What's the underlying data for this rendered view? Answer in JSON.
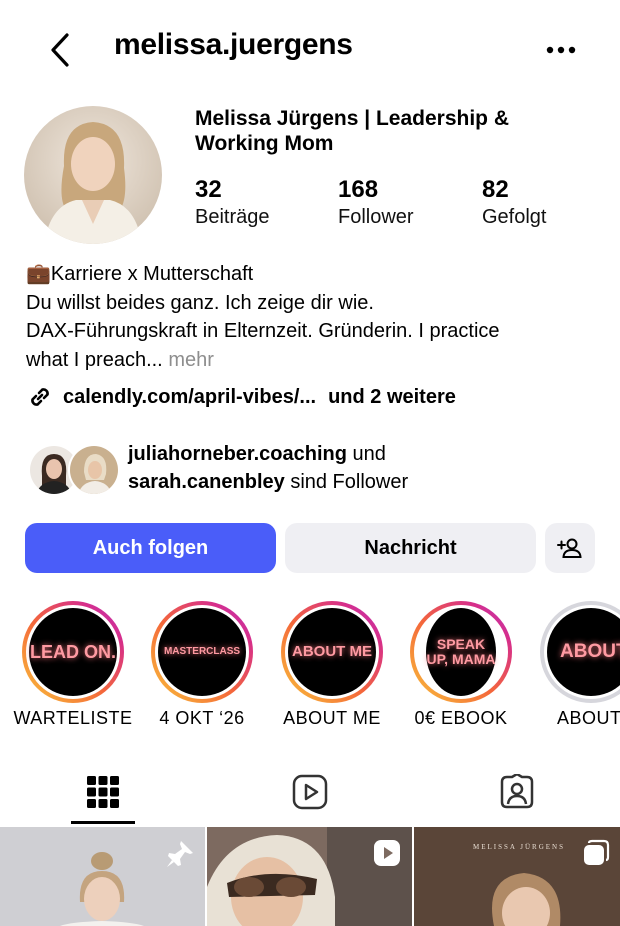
{
  "header": {
    "username": "melissa.juergens",
    "back_icon": "chevron-left-icon",
    "more_icon": "more-horizontal-icon"
  },
  "profile": {
    "display_name": "Melissa Jürgens | Leadership & Working Mom",
    "stats": [
      {
        "value": "32",
        "label": "Beiträge"
      },
      {
        "value": "168",
        "label": "Follower"
      },
      {
        "value": "82",
        "label": "Gefolgt"
      }
    ],
    "bio": {
      "line1_emoji": "💼",
      "line1": "Karriere x Mutterschaft",
      "line2": "Du willst beides ganz. Ich zeige dir wie.",
      "line3": "DAX-Führungskraft in Elternzeit. Gründerin. I practice",
      "line4": "what I preach...",
      "more": "mehr"
    },
    "link": {
      "url": "calendly.com/april-vibes/...",
      "extra": "und 2 weitere"
    }
  },
  "followed_by": {
    "user1": "juliahorneber.coaching",
    "connector": "und",
    "user2": "sarah.canenbley",
    "suffix": "sind Follower"
  },
  "actions": {
    "follow": "Auch folgen",
    "message": "Nachricht"
  },
  "highlights": [
    {
      "cover_text": "LEAD ON.",
      "label": "WARTELISTE"
    },
    {
      "cover_text": "MASTERCLASS",
      "label": "4 OKT ‘26"
    },
    {
      "cover_text": "ABOUT ME",
      "label": "ABOUT ME"
    },
    {
      "cover_text": "SPEAK UP, MAMA",
      "label": "0€ EBOOK"
    },
    {
      "cover_text": "ABOUT",
      "label": "ABOUT"
    }
  ],
  "tabs": [
    "grid-icon",
    "reels-icon",
    "tagged-icon"
  ],
  "posts": [
    {
      "badge_icon": "pin-icon"
    },
    {
      "badge_icon": "reel-play-icon"
    },
    {
      "badge_icon": "carousel-icon",
      "overlay_text": "MELISSA JÜRGENS"
    }
  ],
  "colors": {
    "follow_button": "#4a5df9",
    "secondary_button": "#efeff3",
    "muted_text": "#8e8e8e"
  }
}
